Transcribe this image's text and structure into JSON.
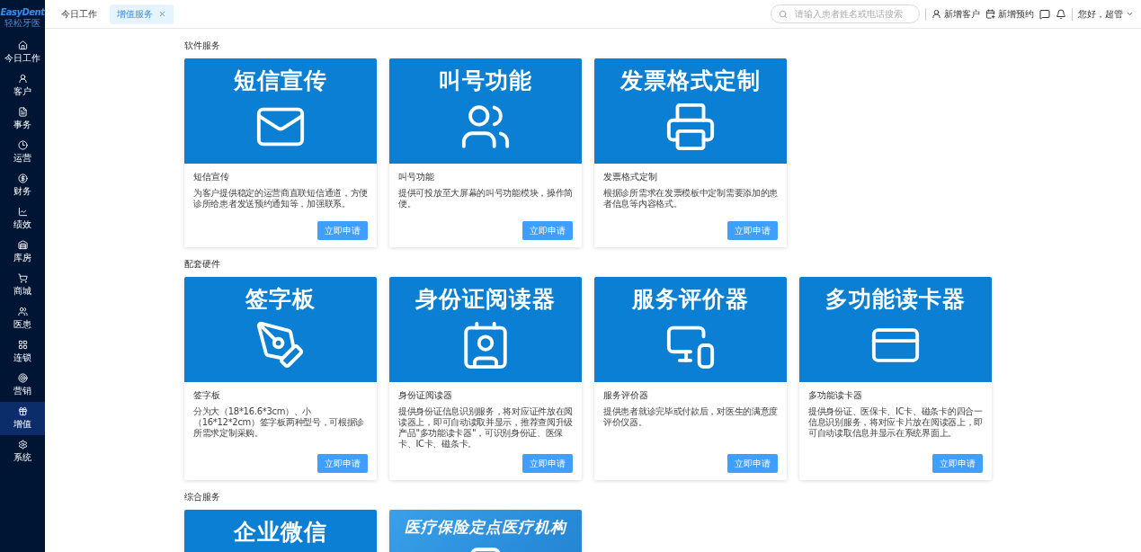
{
  "logo": {
    "name": "EasyDent",
    "subtitle": "轻松牙医"
  },
  "sidebar": {
    "items": [
      {
        "label": "今日工作",
        "selected": false
      },
      {
        "label": "客户",
        "selected": false
      },
      {
        "label": "事务",
        "selected": false
      },
      {
        "label": "运营",
        "selected": false
      },
      {
        "label": "财务",
        "selected": false
      },
      {
        "label": "绩效",
        "selected": false
      },
      {
        "label": "库房",
        "selected": false
      },
      {
        "label": "商城",
        "selected": false
      },
      {
        "label": "医患",
        "selected": false
      },
      {
        "label": "连锁",
        "selected": false
      },
      {
        "label": "营销",
        "selected": false
      },
      {
        "label": "增值",
        "selected": true
      },
      {
        "label": "系统",
        "selected": false
      }
    ]
  },
  "tabs": [
    {
      "label": "今日工作",
      "selected": false,
      "closable": false
    },
    {
      "label": "增值服务",
      "selected": true,
      "closable": true
    }
  ],
  "search": {
    "placeholder": "请输入患者姓名或电话搜索"
  },
  "actions": {
    "new_customer": "新增客户",
    "new_appointment": "新增预约",
    "greeting": "您好，超管"
  },
  "sections": [
    {
      "title": "软件服务",
      "cards": [
        {
          "banner_title": "短信宣传",
          "title": "短信宣传",
          "description": "为客户提供稳定的运营商直联短信通道，方便诊所给患者发送预约通知等，加强联系。",
          "button": "立即申请"
        },
        {
          "banner_title": "叫号功能",
          "title": "叫号功能",
          "description": "提供可投放至大屏幕的叫号功能模块，操作简便。",
          "button": "立即申请"
        },
        {
          "banner_title": "发票格式定制",
          "title": "发票格式定制",
          "description": "根据诊所需求在发票模板中定制需要添加的患者信息等内容格式。",
          "button": "立即申请"
        }
      ]
    },
    {
      "title": "配套硬件",
      "cards": [
        {
          "banner_title": "签字板",
          "title": "签字板",
          "description": "分为大（18*16.6*3cm）、小（16*12*2cm）签字板两种型号，可根据诊所需求定制采购。",
          "button": "立即申请"
        },
        {
          "banner_title": "身份证阅读器",
          "title": "身份证阅读器",
          "description": "提供身份证信息识别服务，将对应证件放在阅读器上，即可自动读取并显示，推荐查阅升级产品\"多功能读卡器\"，可识别身份证、医保卡、IC卡、磁条卡。",
          "button": "立即申请"
        },
        {
          "banner_title": "服务评价器",
          "title": "服务评价器",
          "description": "提供患者就诊完毕或付款后，对医生的满意度评价仪器。",
          "button": "立即申请"
        },
        {
          "banner_title": "多功能读卡器",
          "title": "多功能读卡器",
          "description": "提供身份证、医保卡、IC卡、磁条卡的四合一信息识别服务，将对应卡片放在阅读器上，即可自动读取信息并显示在系统界面上。",
          "button": "立即申请"
        }
      ]
    },
    {
      "title": "综合服务",
      "cards": [
        {
          "banner_title": "企业微信"
        },
        {
          "banner_title": "医疗保险定点医疗机构"
        }
      ]
    }
  ]
}
